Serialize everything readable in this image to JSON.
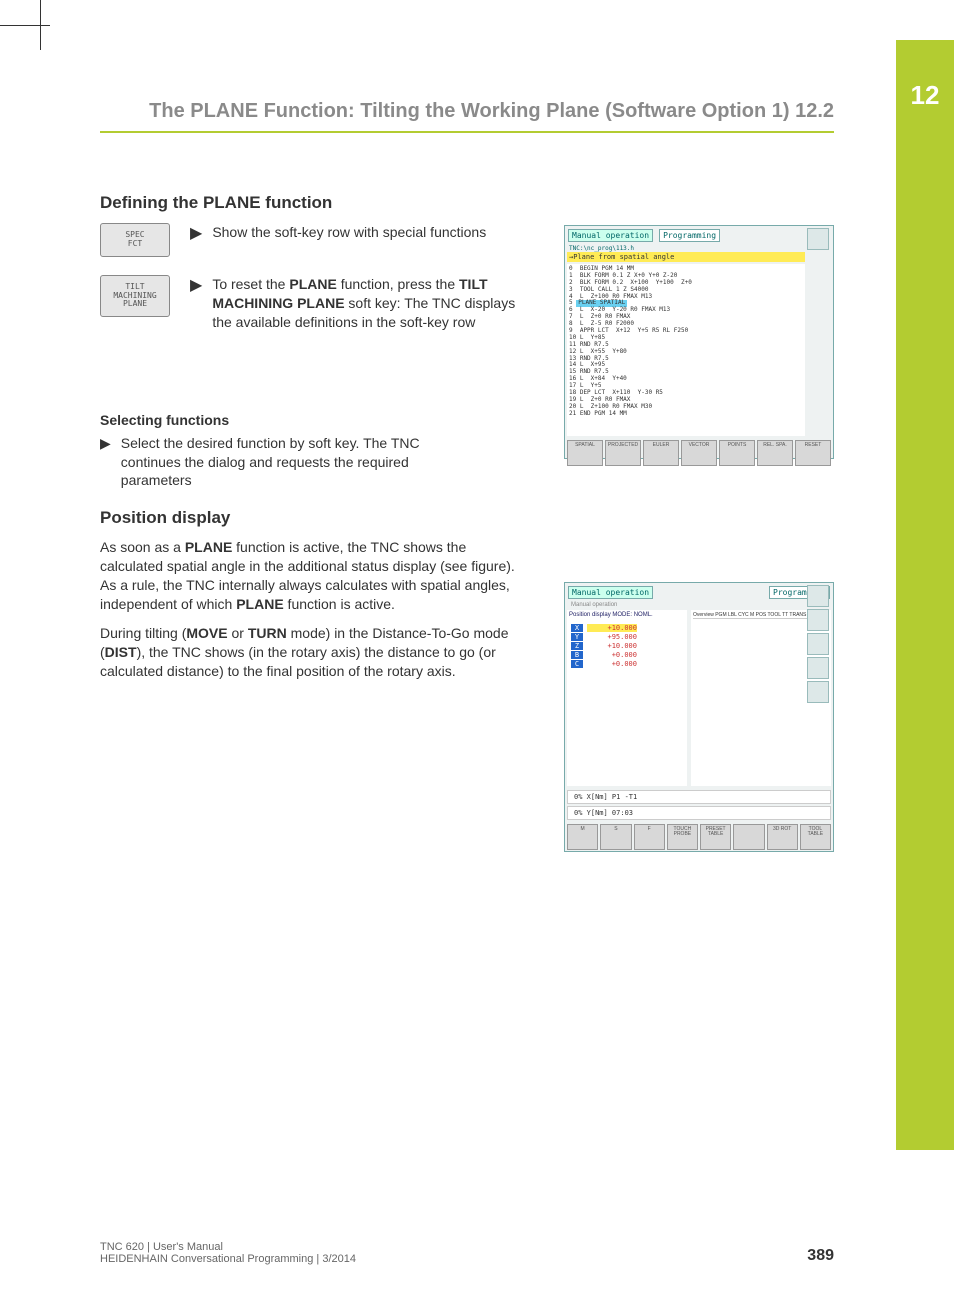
{
  "chapter_number": "12",
  "page_title": "The PLANE Function: Tilting the Working Plane (Software Option 1)   12.2",
  "section1_title": "Defining the PLANE function",
  "softkey1": "SPEC\nFCT",
  "softkey2": "TILT\nMACHINING\nPLANE",
  "bullet1": "Show the soft-key row with special functions",
  "bullet2_pre": "To reset the ",
  "bullet2_b1": "PLANE",
  "bullet2_mid1": " function, press the ",
  "bullet2_b2": "TILT MACHINING PLANE",
  "bullet2_mid2": " soft key: The TNC displays the available definitions in the soft-key row",
  "sub1_title": "Selecting functions",
  "sub1_bullet": "Select the desired function by soft key. The TNC continues the dialog and requests the required parameters",
  "section2_title": "Position display",
  "p1_a": "As soon as a ",
  "p1_b1": "PLANE",
  "p1_b": " function is active, the TNC shows the calculated spatial angle in the additional status display (see figure). As a rule, the TNC internally always calculates with spatial angles, independent of which ",
  "p1_b2": "PLANE",
  "p1_c": " function is active.",
  "p2_a": "During tilting (",
  "p2_b1": "MOVE",
  "p2_b": " or ",
  "p2_b2": "TURN",
  "p2_c": " mode) in the Distance-To-Go mode (",
  "p2_b3": "DIST",
  "p2_d": "), the TNC shows (in the rotary axis) the distance to go (or calculated distance) to the final position of the rotary axis.",
  "fig1": {
    "mode1": "Manual operation",
    "mode2": "Programming",
    "filepath": "TNC:\\nc_prog\\113.h",
    "hl_line": "→Plane from spatial angle",
    "code": "0  BEGIN PGM 14 MM\n1  BLK FORM 0.1 Z X+0 Y+0 Z-20\n2  BLK FORM 0.2  X+100  Y+100  Z+0\n3  TOOL CALL 1 Z S4000\n4  L  Z+100 R0 FMAX M13",
    "hl_word": "PLANE SPATIAL",
    "code2": "6  L  X-20  Y-20 R0 FMAX M13\n7  L  Z+0 R0 FMAX\n8  L  Z-5 R0 F2000\n9  APPR LCT  X+12  Y+5 R5 RL F250\n10 L  Y+85\n11 RND R7.5\n12 L  X+55  Y+80\n13 RND R7.5\n14 L  X+95\n15 RND R7.5\n16 L  X+84  Y+40\n17 L  Y+5\n18 DEP LCT  X+110  Y-30 R5\n19 L  Z+0 R0 FMAX\n20 L  Z+100 R0 FMAX M30\n21 END PGM 14 MM",
    "sk": [
      "SPATIAL",
      "PROJECTED",
      "EULER",
      "VECTOR",
      "POINTS",
      "REL. SPA.",
      "RESET"
    ]
  },
  "fig2": {
    "mode1": "Manual operation",
    "mode2": "Programming",
    "sub": "Manual operation",
    "pos_label": "Position display MODE: NOML.",
    "axes": [
      {
        "a": "X",
        "v": "+10.000"
      },
      {
        "a": "Y",
        "v": "+95.000"
      },
      {
        "a": "Z",
        "v": "+10.000"
      },
      {
        "a": "B",
        "v": "+0.000"
      },
      {
        "a": "C",
        "v": "+0.000"
      }
    ],
    "status1": "0% X[Nm] P1 -T1",
    "status2": "0% Y[Nm] 07:03",
    "bottom_sk": [
      "M",
      "S",
      "F",
      "TOUCH PROBE",
      "PRESET TABLE",
      "",
      "3D ROT",
      "TOOL TABLE"
    ]
  },
  "footer_l1": "TNC 620 | User's Manual",
  "footer_l2": "HEIDENHAIN Conversational Programming | 3/2014",
  "page_number": "389"
}
